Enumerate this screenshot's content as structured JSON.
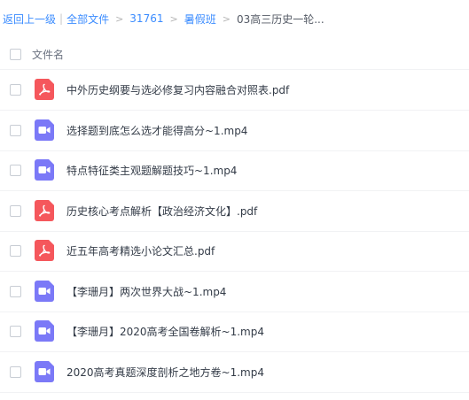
{
  "breadcrumb": {
    "back_label": "返回上一级",
    "items": [
      "全部文件",
      "31761",
      "暑假班"
    ],
    "current": "03高三历史一轮..."
  },
  "header": {
    "column_label": "文件名"
  },
  "colors": {
    "link": "#3b8cff",
    "pdf_icon": "#f5575c",
    "video_icon": "#7b79f7"
  },
  "files": [
    {
      "name": "中外历史纲要与选必修复习内容融合对照表.pdf",
      "type": "pdf",
      "icon": "pdf-icon"
    },
    {
      "name": "选择题到底怎么选才能得高分~1.mp4",
      "type": "video",
      "icon": "video-icon"
    },
    {
      "name": "特点特征类主观题解题技巧~1.mp4",
      "type": "video",
      "icon": "video-icon"
    },
    {
      "name": "历史核心考点解析【政治经济文化】.pdf",
      "type": "pdf",
      "icon": "pdf-icon"
    },
    {
      "name": "近五年高考精选小论文汇总.pdf",
      "type": "pdf",
      "icon": "pdf-icon"
    },
    {
      "name": "【李珊月】两次世界大战~1.mp4",
      "type": "video",
      "icon": "video-icon"
    },
    {
      "name": "【李珊月】2020高考全国卷解析~1.mp4",
      "type": "video",
      "icon": "video-icon"
    },
    {
      "name": "2020高考真题深度剖析之地方卷~1.mp4",
      "type": "video",
      "icon": "video-icon"
    }
  ]
}
